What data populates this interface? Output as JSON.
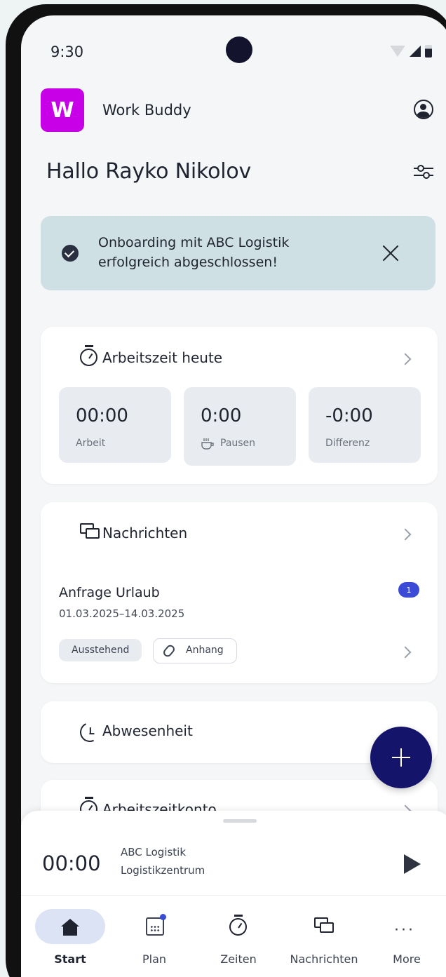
{
  "status_bar": {
    "time": "9:30"
  },
  "app": {
    "logo_letter": "W",
    "name": "Work Buddy"
  },
  "greeting": "Hallo Rayko Nikolov",
  "banner": {
    "text": "Onboarding mit ABC Logistik erfolgreich abgeschlossen!"
  },
  "worktime_card": {
    "title": "Arbeitszeit heute",
    "stats": [
      {
        "value": "00:00",
        "label": "Arbeit"
      },
      {
        "value": "0:00",
        "label": "Pausen"
      },
      {
        "value": "-0:00",
        "label": "Differenz"
      }
    ]
  },
  "messages_card": {
    "title": "Nachrichten",
    "item": {
      "title": "Anfrage Urlaub",
      "date": "01.03.2025–14.03.2025",
      "badge": "1",
      "status_chip": "Ausstehend",
      "attachment_chip": "Anhang"
    }
  },
  "absence_card": {
    "title": "Abwesenheit"
  },
  "account_card": {
    "title": "Arbeitszeitkonto"
  },
  "tracker": {
    "timer": "00:00",
    "company": "ABC Logistik",
    "location": "Logistikzentrum"
  },
  "nav": {
    "items": [
      {
        "label": "Start",
        "icon": "home-icon",
        "active": true
      },
      {
        "label": "Plan",
        "icon": "calendar-icon"
      },
      {
        "label": "Zeiten",
        "icon": "stopwatch-icon"
      },
      {
        "label": "Nachrichten",
        "icon": "chat-icon"
      },
      {
        "label": "More",
        "icon": "more-icon"
      }
    ]
  },
  "colors": {
    "accent": "#14146b",
    "logo": "#c800e8",
    "banner": "#cfe0e4",
    "badge": "#3b4bd6",
    "nav_active": "#dbe3f4"
  }
}
